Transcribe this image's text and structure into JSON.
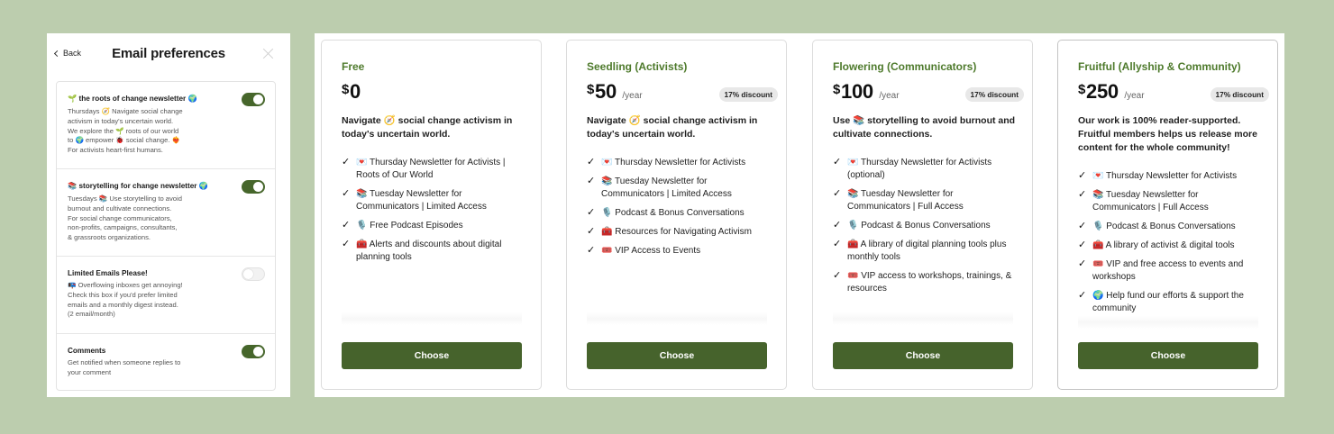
{
  "prefs": {
    "back_label": "Back",
    "title": "Email preferences",
    "items": [
      {
        "name": "🌱 the roots of change newsletter 🌍",
        "desc": "Thursdays 🧭 Navigate social change\nactivism in today's uncertain world.\nWe explore the 🌱 roots of our world\nto 🌍 empower 🐞 social change. ❤️‍🔥\nFor activists heart-first humans.",
        "enabled": true
      },
      {
        "name": "📚 storytelling for change newsletter 🌍",
        "desc": "Tuesdays 📚 Use storytelling to avoid\nburnout and cultivate connections.\nFor social change communicators,\nnon-profits, campaigns, consultants,\n& grassroots organizations.",
        "enabled": true
      },
      {
        "name": "Limited Emails Please!",
        "desc": "📭 Overflowing inboxes get annoying!\nCheck this box if you'd prefer limited\nemails and a monthly digest instead.\n(2 email/month)",
        "enabled": false
      },
      {
        "name": "Comments",
        "desc": "Get notified when someone replies to\nyour comment",
        "enabled": true
      }
    ]
  },
  "plans": [
    {
      "name": "Free",
      "currency": "$",
      "amount": "0",
      "period": "",
      "discount": "",
      "tagline": "Navigate 🧭  social change activism in today's uncertain world.",
      "features": [
        "💌 Thursday Newsletter for Activists | Roots of Our World",
        "📚 Tuesday Newsletter for Communicators | Limited Access",
        "🎙️ Free Podcast Episodes",
        "🧰 Alerts and discounts about digital planning tools"
      ],
      "button": "Choose"
    },
    {
      "name": "Seedling (Activists)",
      "currency": "$",
      "amount": "50",
      "period": "/year",
      "discount": "17% discount",
      "tagline": "Navigate 🧭  social change activism in today's uncertain world.",
      "features": [
        "💌 Thursday Newsletter for Activists",
        "📚 Tuesday Newsletter for Communicators | Limited Access",
        "🎙️ Podcast & Bonus Conversations",
        "🧰 Resources for Navigating Activism",
        "🎟️ VIP Access to Events"
      ],
      "button": "Choose"
    },
    {
      "name": "Flowering (Communicators)",
      "currency": "$",
      "amount": "100",
      "period": "/year",
      "discount": "17% discount",
      "tagline": "Use 📚 storytelling to avoid burnout and cultivate connections.",
      "features": [
        "💌 Thursday Newsletter for Activists (optional)",
        "📚 Tuesday Newsletter for Communicators | Full Access",
        "🎙️ Podcast & Bonus Conversations",
        "🧰 A library of digital planning tools plus monthly tools",
        "🎟️ VIP access to workshops, trainings, & resources"
      ],
      "button": "Choose"
    },
    {
      "name": "Fruitful (Allyship & Community)",
      "currency": "$",
      "amount": "250",
      "period": "/year",
      "discount": "17% discount",
      "tagline": "Our work is 100% reader-supported. Fruitful members helps us release more content for the whole community!",
      "features": [
        "💌 Thursday Newsletter for Activists",
        "📚 Tuesday Newsletter for Communicators | Full Access",
        "🎙️ Podcast & Bonus Conversations",
        "🧰 A library of activist & digital tools",
        "🎟️ VIP and free access to events and workshops",
        "🌍 Help fund our efforts & support the community"
      ],
      "button": "Choose"
    }
  ]
}
